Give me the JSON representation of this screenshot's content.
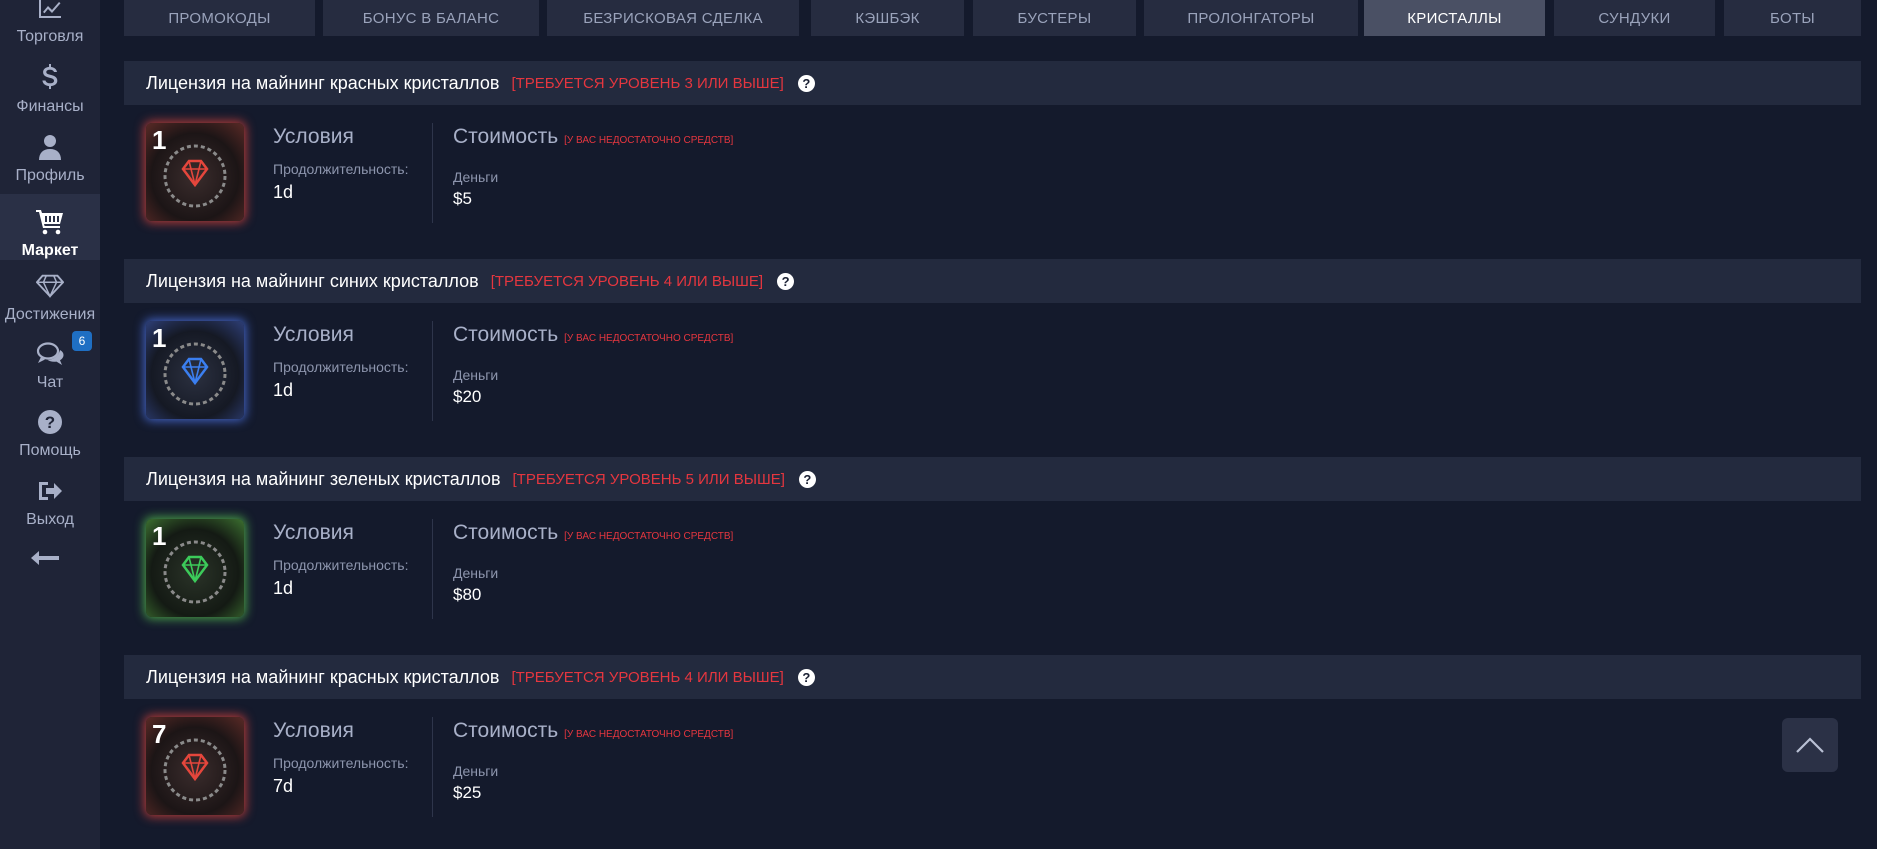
{
  "sidebar": {
    "items": [
      {
        "label": "Торговля",
        "icon": "chart-line-icon"
      },
      {
        "label": "Финансы",
        "icon": "dollar-icon"
      },
      {
        "label": "Профиль",
        "icon": "user-icon"
      },
      {
        "label": "Маркет",
        "icon": "cart-icon"
      },
      {
        "label": "Достижения",
        "icon": "diamond-icon"
      },
      {
        "label": "Чат",
        "icon": "chat-icon"
      },
      {
        "label": "Помощь",
        "icon": "help-circle-icon"
      },
      {
        "label": "Выход",
        "icon": "logout-icon"
      }
    ],
    "chat_badge": "6",
    "back_icon": "arrow-left-icon"
  },
  "tabs": [
    {
      "label": "Промокоды"
    },
    {
      "label": "Бонус в баланс"
    },
    {
      "label": "Безрисковая сделка"
    },
    {
      "label": "Кэшбэк"
    },
    {
      "label": "Бустеры"
    },
    {
      "label": "Пролонгаторы"
    },
    {
      "label": "Кристаллы"
    },
    {
      "label": "Сундуки"
    },
    {
      "label": "Боты"
    }
  ],
  "common": {
    "conditions_title": "Условия",
    "duration_label": "Продолжительность:",
    "cost_title": "Стоимость",
    "insufficient_funds": "[у вас недостаточно средств]",
    "money_label": "Деньги"
  },
  "cards": [
    {
      "title": "Лицензия на майнинг красных кристаллов",
      "requirement": "[ТРЕБУЕТСЯ УРОВЕНЬ 3 ИЛИ ВЫШЕ]",
      "badge": "1",
      "duration": "1d",
      "price": "$5",
      "color": "#e5463c"
    },
    {
      "title": "Лицензия на майнинг синих кристаллов",
      "requirement": "[ТРЕБУЕТСЯ УРОВЕНЬ 4 ИЛИ ВЫШЕ]",
      "badge": "1",
      "duration": "1d",
      "price": "$20",
      "color": "#3b7ff0"
    },
    {
      "title": "Лицензия на майнинг зеленых кристаллов",
      "requirement": "[ТРЕБУЕТСЯ УРОВЕНЬ 5 ИЛИ ВЫШЕ]",
      "badge": "1",
      "duration": "1d",
      "price": "$80",
      "color": "#3ccb5a"
    },
    {
      "title": "Лицензия на майнинг красных кристаллов",
      "requirement": "[ТРЕБУЕТСЯ УРОВЕНЬ 4 ИЛИ ВЫШЕ]",
      "badge": "7",
      "duration": "7d",
      "price": "$25",
      "color": "#e5463c"
    }
  ],
  "help_icon_glyph": "?",
  "scroll_top_icon": "chevron-up-icon"
}
